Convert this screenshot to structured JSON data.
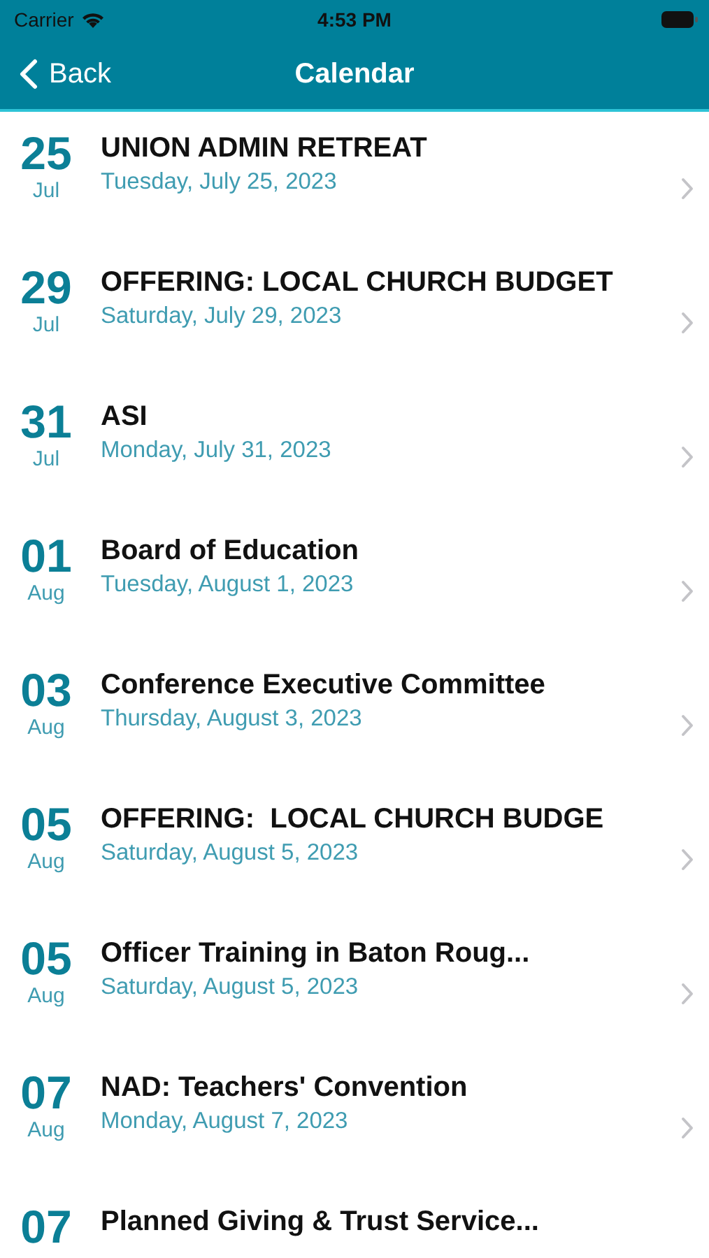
{
  "status_bar": {
    "carrier": "Carrier",
    "time": "4:53 PM"
  },
  "nav_bar": {
    "back_label": "Back",
    "title": "Calendar"
  },
  "events": [
    {
      "day": "25",
      "month": "Jul",
      "title": "UNION ADMIN RETREAT",
      "date": "Tuesday, July 25, 2023"
    },
    {
      "day": "29",
      "month": "Jul",
      "title": "OFFERING: LOCAL CHURCH BUDGET",
      "date": "Saturday, July 29, 2023"
    },
    {
      "day": "31",
      "month": "Jul",
      "title": "ASI",
      "date": "Monday, July 31, 2023"
    },
    {
      "day": "01",
      "month": "Aug",
      "title": "Board of Education",
      "date": "Tuesday, August 1, 2023"
    },
    {
      "day": "03",
      "month": "Aug",
      "title": "Conference Executive Committee",
      "date": "Thursday, August 3, 2023"
    },
    {
      "day": "05",
      "month": "Aug",
      "title": "OFFERING:  LOCAL CHURCH BUDGE",
      "date": "Saturday, August 5, 2023"
    },
    {
      "day": "05",
      "month": "Aug",
      "title": "Officer Training in Baton Roug...",
      "date": "Saturday, August 5, 2023"
    },
    {
      "day": "07",
      "month": "Aug",
      "title": "NAD: Teachers' Convention",
      "date": "Monday, August 7, 2023"
    },
    {
      "day": "07",
      "title": "Planned Giving & Trust Service..."
    }
  ]
}
